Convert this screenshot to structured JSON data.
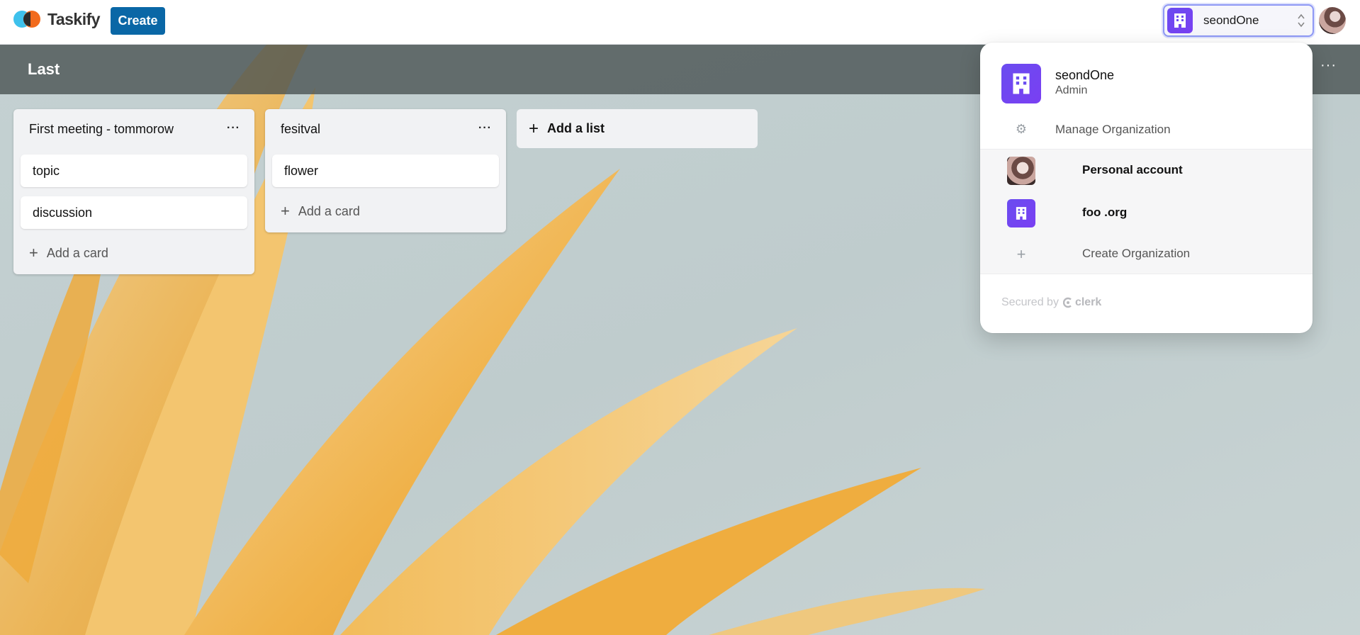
{
  "app": {
    "name": "Taskify"
  },
  "topnav": {
    "create_label": "Create",
    "org_switcher": {
      "name": "seondOne"
    }
  },
  "board": {
    "title": "Last",
    "more": "···",
    "lists": [
      {
        "title": "First meeting - tommorow",
        "cards": [
          "topic",
          "discussion"
        ],
        "add_card_label": "Add a card"
      },
      {
        "title": "fesitval",
        "cards": [
          "flower"
        ],
        "add_card_label": "Add a card"
      }
    ],
    "add_list_label": "Add a list"
  },
  "dropdown": {
    "active_org": {
      "name": "seondOne",
      "role": "Admin"
    },
    "manage_label": "Manage Organization",
    "others": [
      {
        "label": "Personal account"
      },
      {
        "label": "foo .org"
      }
    ],
    "create_label": "Create Organization",
    "footer": {
      "secured_by": "Secured by",
      "brand": "clerk"
    }
  },
  "colors": {
    "primary": "#0a67a6",
    "org_accent": "#6a4cf0",
    "switcher_border": "#8e98f5"
  }
}
